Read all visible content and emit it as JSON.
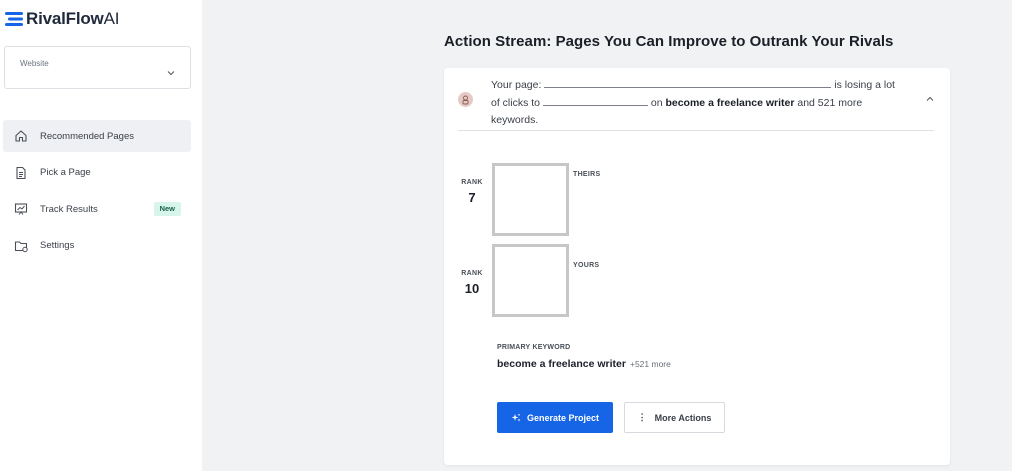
{
  "brand": {
    "name": "RivalFlow",
    "suffix": "AI",
    "color": "#1565e6"
  },
  "website_select": {
    "label": "Website",
    "icon": "chevron-down-icon"
  },
  "sidebar": {
    "items": [
      {
        "label": "Recommended Pages",
        "icon": "home-icon",
        "active": true
      },
      {
        "label": "Pick a Page",
        "icon": "document-icon"
      },
      {
        "label": "Track Results",
        "icon": "chart-icon",
        "badge": "New"
      },
      {
        "label": "Settings",
        "icon": "folder-gear-icon"
      }
    ]
  },
  "main": {
    "title": "Action Stream: Pages You Can Improve to Outrank Your Rivals",
    "card": {
      "summary": {
        "part1": "Your page:",
        "part2": "is losing a lot of clicks to",
        "part3": "on",
        "keyword": "become a freelance writer",
        "part4": "and 521 more keywords."
      },
      "theirs": {
        "rank_label": "RANK",
        "rank": "7",
        "label": "THEIRS"
      },
      "yours": {
        "rank_label": "RANK",
        "rank": "10",
        "label": "YOURS"
      },
      "primary_keyword": {
        "label": "PRIMARY KEYWORD",
        "value": "become a freelance writer",
        "more": "+521 more"
      },
      "actions": {
        "generate": "Generate Project",
        "more": "More Actions"
      }
    }
  }
}
